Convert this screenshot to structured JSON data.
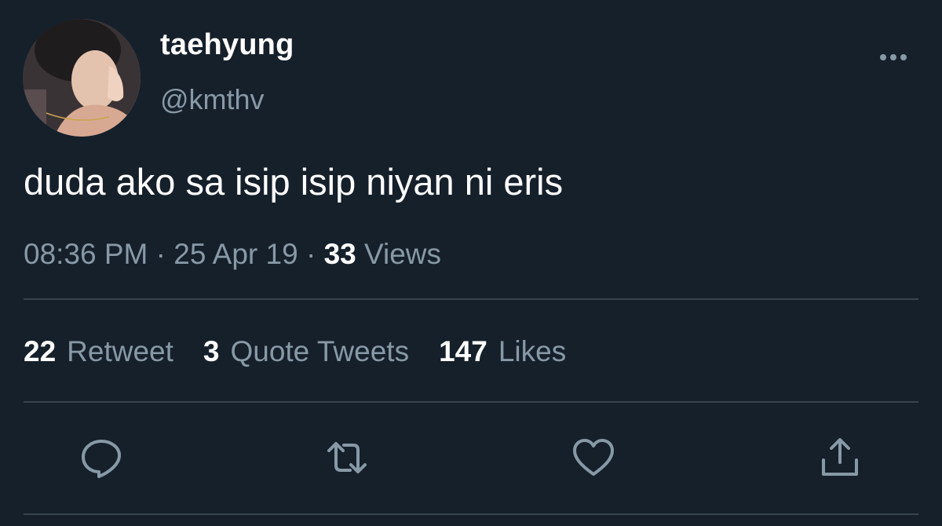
{
  "user": {
    "display_name": "taehyung",
    "handle": "@kmthv",
    "avatar_icon": "profile-photo"
  },
  "tweet": {
    "text": "duda ako sa isip isip niyan ni eris",
    "time": "08:36 PM",
    "separator": "·",
    "date": "25 Apr 19",
    "views_count": "33",
    "views_label": "Views"
  },
  "stats": {
    "retweets_count": "22",
    "retweets_label": "Retweet",
    "quotes_count": "3",
    "quotes_label": "Quote Tweets",
    "likes_count": "147",
    "likes_label": "Likes"
  },
  "actions": {
    "reply_icon": "reply-icon",
    "retweet_icon": "retweet-icon",
    "like_icon": "heart-icon",
    "share_icon": "share-icon",
    "more_icon": "more-icon"
  },
  "colors": {
    "background": "#15202b",
    "primary_text": "#ffffff",
    "secondary_text": "#8899a6",
    "divider": "#38444d"
  }
}
